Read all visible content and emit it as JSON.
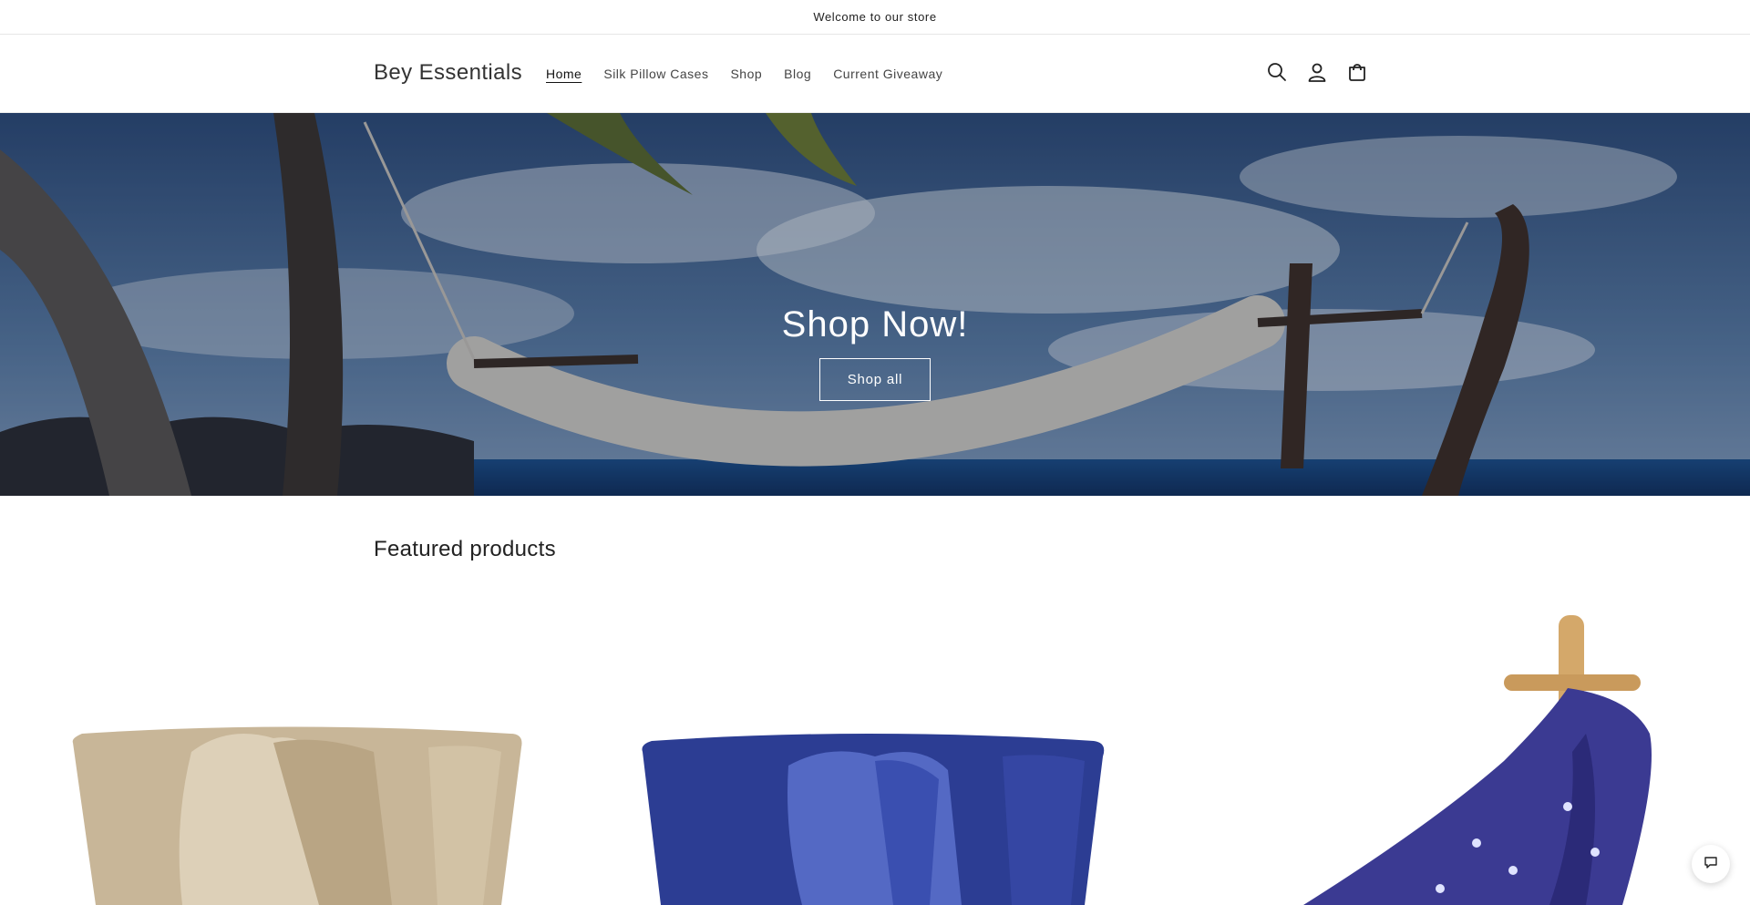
{
  "announcement": {
    "text": "Welcome to our store"
  },
  "header": {
    "logo": "Bey Essentials",
    "nav": [
      {
        "label": "Home",
        "active": true
      },
      {
        "label": "Silk Pillow Cases"
      },
      {
        "label": "Shop"
      },
      {
        "label": "Blog"
      },
      {
        "label": "Current Giveaway"
      }
    ],
    "icons": [
      "search-icon",
      "account-icon",
      "cart-icon"
    ]
  },
  "hero": {
    "heading": "Shop Now!",
    "button_label": "Shop all"
  },
  "featured": {
    "title": "Featured products",
    "products": [
      {
        "image": "champagne-silk-pillowcase",
        "color": "#c9b79a"
      },
      {
        "image": "navy-silk-pillowcase",
        "color": "#2f3f8e"
      },
      {
        "image": "paisley-silk-scarf-on-stand",
        "color": "#3c3a93"
      }
    ]
  },
  "chat": {
    "icon": "chat-icon"
  },
  "colors": {
    "text": "#121212",
    "border": "#e6e6e6",
    "hero_overlay": "#1c2a48"
  }
}
